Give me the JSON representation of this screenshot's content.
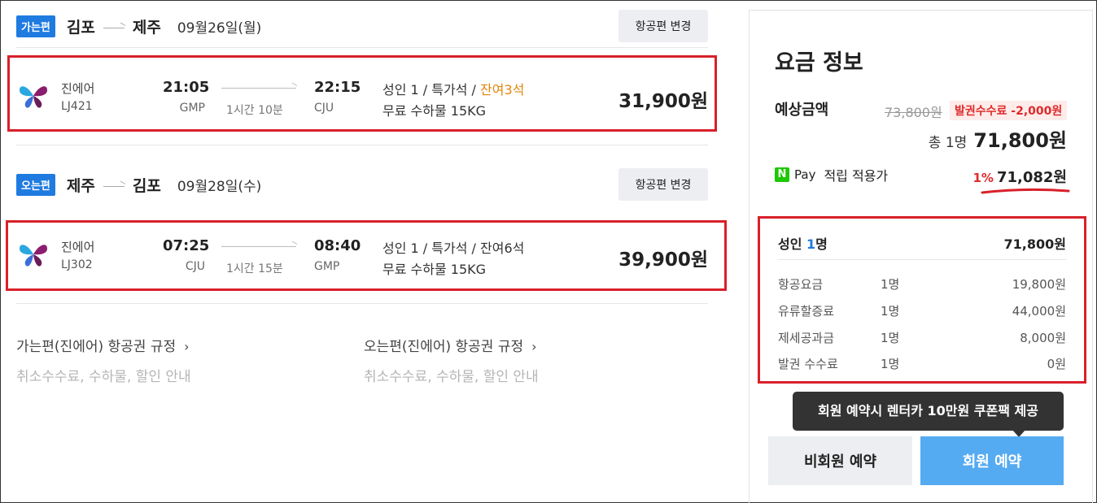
{
  "outbound": {
    "badge": "가는편",
    "from": "김포",
    "to": "제주",
    "date": "09월26일(월)",
    "change_label": "항공편 변경",
    "flight": {
      "airline": "진에어",
      "flight_no": "LJ421",
      "dep_time": "21:05",
      "dep_code": "GMP",
      "duration": "1시간 10분",
      "arr_time": "22:15",
      "arr_code": "CJU",
      "passenger_class": "성인 1 / 특가석 / ",
      "seats_left": "잔여3석",
      "baggage": "무료 수하물 15KG",
      "price": "31,900원"
    },
    "rule_title": "가는편(진에어) 항공권 규정",
    "rule_sub": "취소수수료, 수하물, 할인 안내"
  },
  "inbound": {
    "badge": "오는편",
    "from": "제주",
    "to": "김포",
    "date": "09월28일(수)",
    "change_label": "항공편 변경",
    "flight": {
      "airline": "진에어",
      "flight_no": "LJ302",
      "dep_time": "07:25",
      "dep_code": "CJU",
      "duration": "1시간 15분",
      "arr_time": "08:40",
      "arr_code": "GMP",
      "passenger_class": "성인 1 / 특가석 / ",
      "seats_left": "잔여6석",
      "baggage": "무료 수하물 15KG",
      "price": "39,900원"
    },
    "rule_title": "오는편(진에어) 항공권 규정",
    "rule_sub": "취소수수료, 수하물, 할인 안내"
  },
  "fare": {
    "title": "요금 정보",
    "estimate_label": "예상금액",
    "original_price": "73,800원",
    "fee_discount": "발권수수료 -2,000원",
    "total_prefix": "총 1명",
    "total_amount": "71,800원",
    "npay_icon": "N",
    "npay_pay": "Pay",
    "npay_label": "적립 적용가",
    "npay_pct": "1%",
    "npay_amount": "71,082원",
    "breakdown": {
      "adult_prefix": "성인 ",
      "adult_count": "1",
      "adult_suffix": "명",
      "adult_total": "71,800원",
      "rows": [
        {
          "label": "항공요금",
          "qty": "1명",
          "amount": "19,800원"
        },
        {
          "label": "유류할증료",
          "qty": "1명",
          "amount": "44,000원"
        },
        {
          "label": "제세공과금",
          "qty": "1명",
          "amount": "8,000원"
        },
        {
          "label": "발권 수수료",
          "qty": "1명",
          "amount": "0원"
        }
      ]
    },
    "tooltip": "회원 예약시 렌터카 10만원 쿠폰팩 제공",
    "guest_button": "비회원 예약",
    "member_button": "회원 예약"
  },
  "colors": {
    "accent_blue": "#1f7be0",
    "member_button": "#55abf2",
    "highlight_red": "#d9202a",
    "warning_orange": "#e3860b"
  }
}
